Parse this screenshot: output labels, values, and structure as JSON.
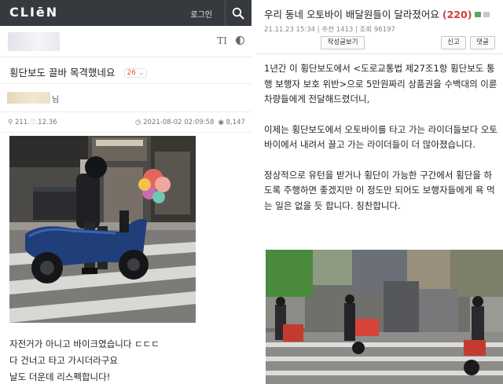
{
  "left": {
    "logo": "CLIēN",
    "login_label": "로그인",
    "title": "횡단보도 끌바 목격했네요",
    "comment_count": "26",
    "username_suffix": "님",
    "ip": "211.♡.12.36",
    "datetime": "2021-08-02 02:09:58",
    "views": "8,147",
    "body_lines": [
      "자전거가 아니고 바이크였습니다 ㄷㄷㄷ",
      "다 건너고 타고 가시더라구요",
      "날도 더운데 리스펙합니다!"
    ],
    "photo": {
      "description_icon": "photo-scooter-rider"
    }
  },
  "right": {
    "title": "우리 동네 오토바이 배달원들이 달라졌어요",
    "comment_count": "(220)",
    "meta": "21.11.23  15:34  |  추천 1413  |  조회 96197",
    "author_posts_btn": "작성글보기",
    "report_btn": "신고",
    "reply_btn": "댓글",
    "paragraphs": [
      "1년간 이 횡단보도에서  <도로교통법 제27조1항 횡단보도 통행 보행자 보호 위반>으로 5만원짜리 상품권을 수백대의 이륜차량들에게 전달해드렸더니,",
      "이제는 횡단보도에서 오토바이를 타고 가는 라이더들보다 오토바이에서 내려서 끌고 가는 라이더들이 더 많아졌습니다.",
      "정상적으로 유턴을 받거나 횡단이 가능한 구간에서 횡단을 하도록 주행하면 좋겠지만 이 정도만 되어도 보행자들에게 욕 먹는 일은 없을 듯 합니다. 칭찬합니다."
    ]
  },
  "colors": {
    "topbar": "#363a3f",
    "accent_red": "#d63a3a",
    "badge_text": "#e4573b"
  }
}
